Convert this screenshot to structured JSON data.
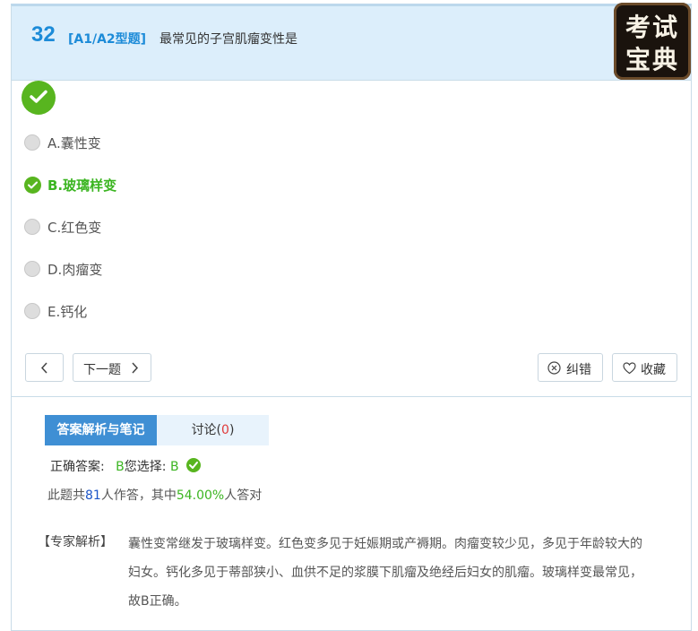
{
  "question": {
    "number": "32",
    "type": "[A1/A2型题]",
    "text": "最常见的子宫肌瘤变性是"
  },
  "logo": {
    "line1": "考试",
    "line2": "宝典"
  },
  "options": [
    {
      "label": "A.囊性变",
      "state": "none"
    },
    {
      "label": "B.玻璃样变",
      "state": "correct"
    },
    {
      "label": "C.红色变",
      "state": "none"
    },
    {
      "label": "D.肉瘤变",
      "state": "none"
    },
    {
      "label": "E.钙化",
      "state": "none"
    }
  ],
  "nav": {
    "prev_icon": "chevron-left-icon",
    "next_label": "下一题",
    "report_label": "纠错",
    "favorite_label": "收藏"
  },
  "tabs": {
    "analysis_label": "答案解析与笔记",
    "discussion_label": "讨论(",
    "discussion_count": "0",
    "discussion_close": ")"
  },
  "answer": {
    "correct_label": "正确答案:",
    "correct_value": "B",
    "selected_label": "您选择:",
    "selected_value": "B"
  },
  "stats": {
    "prefix": "此题共",
    "count": "81",
    "middle": "人作答，其中",
    "percent": "54.00%",
    "suffix": "人答对"
  },
  "explanation": {
    "label": "【专家解析】",
    "text": "囊性变常继发于玻璃样变。红色变多见于妊娠期或产褥期。肉瘤变较少见，多见于年龄较大的妇女。钙化多见于蒂部狭小、血供不足的浆膜下肌瘤及绝经后妇女的肌瘤。玻璃样变最常见，故B正确。"
  },
  "colors": {
    "accent": "#1c8bd8",
    "correct": "#58b51f",
    "tab_active": "#3f8fd4",
    "header_bg": "#dceefb"
  }
}
